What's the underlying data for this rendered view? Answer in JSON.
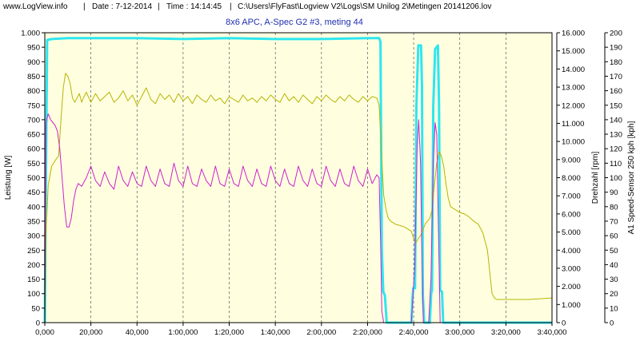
{
  "header": {
    "site": "www.LogView.info",
    "sep": "|",
    "date": "Date : 7-12-2014",
    "time": "Time : 14:14:45",
    "path": "C:\\Users\\FlyFast\\Logview V2\\Logs\\SM Unilog 2\\Metingen 20141206.lov"
  },
  "chart_data": {
    "type": "line",
    "title": "8x6 APC, A-Spec G2 #3, meting 44",
    "x": {
      "label": "",
      "unit": "seconds",
      "range": [
        0,
        220
      ],
      "ticks": [
        0,
        20,
        40,
        60,
        80,
        100,
        120,
        140,
        160,
        180,
        200,
        220
      ],
      "tick_labels": [
        "0,000",
        "20,000",
        "40,000",
        "1:00,000",
        "1:20,000",
        "1:40,000",
        "2:00,000",
        "2:20,000",
        "2:40,000",
        "3:00,000",
        "3:20,000",
        "3:40,000"
      ]
    },
    "axes": {
      "left": {
        "label": "Leistung [W]",
        "range": [
          0,
          1000
        ],
        "ticks": [
          0,
          50,
          100,
          150,
          200,
          250,
          300,
          350,
          400,
          450,
          500,
          550,
          600,
          650,
          700,
          750,
          800,
          850,
          900,
          950,
          1000
        ],
        "tick_labels": [
          "0",
          "50",
          "100",
          "150",
          "200",
          "250",
          "300",
          "350",
          "400",
          "450",
          "500",
          "550",
          "600",
          "650",
          "700",
          "750",
          "800",
          "850",
          "900",
          "950",
          "1.000"
        ]
      },
      "right1": {
        "label": "Drehzahl [rpm]",
        "range": [
          0,
          16000
        ],
        "ticks": [
          0,
          1000,
          2000,
          3000,
          4000,
          5000,
          6000,
          7000,
          8000,
          9000,
          10000,
          11000,
          12000,
          13000,
          14000,
          15000,
          16000
        ],
        "tick_labels": [
          "0",
          "1.000",
          "2.000",
          "3.000",
          "4.000",
          "5.000",
          "6.000",
          "7.000",
          "8.000",
          "9.000",
          "10.000",
          "11.000",
          "12.000",
          "13.000",
          "14.000",
          "15.000",
          "16.000"
        ]
      },
      "right2": {
        "label": "A1 Speed-Sensor 250 kph [kph]",
        "range": [
          0,
          200
        ],
        "ticks": [
          0,
          10,
          20,
          30,
          40,
          50,
          60,
          70,
          80,
          90,
          100,
          110,
          120,
          130,
          140,
          150,
          160,
          170,
          180,
          190,
          200
        ],
        "tick_labels": [
          "0",
          "10",
          "20",
          "30",
          "40",
          "50",
          "60",
          "70",
          "80",
          "90",
          "100",
          "110",
          "120",
          "130",
          "140",
          "150",
          "160",
          "170",
          "180",
          "190",
          "200"
        ]
      }
    },
    "series": [
      {
        "axis": "right1",
        "color": "#2ee6f0",
        "width": 3,
        "points": [
          [
            0,
            0
          ],
          [
            1,
            15600
          ],
          [
            3,
            15650
          ],
          [
            10,
            15700
          ],
          [
            20,
            15700
          ],
          [
            40,
            15700
          ],
          [
            60,
            15650
          ],
          [
            80,
            15700
          ],
          [
            100,
            15650
          ],
          [
            120,
            15650
          ],
          [
            140,
            15700
          ],
          [
            145,
            15700
          ],
          [
            145.6,
            15500
          ],
          [
            146.2,
            4000
          ],
          [
            146.8,
            1700
          ],
          [
            147.5,
            1500
          ],
          [
            148.3,
            0
          ],
          [
            159,
            0
          ],
          [
            159.4,
            1200
          ],
          [
            159.8,
            1900
          ],
          [
            160.6,
            1900
          ],
          [
            161.2,
            12000
          ],
          [
            162,
            15300
          ],
          [
            163.2,
            15300
          ],
          [
            163.6,
            13000
          ],
          [
            164,
            1500
          ],
          [
            164.6,
            0
          ],
          [
            167,
            0
          ],
          [
            167.6,
            1600
          ],
          [
            168,
            1800
          ],
          [
            168.5,
            12000
          ],
          [
            169.3,
            15100
          ],
          [
            170.5,
            15300
          ],
          [
            171,
            12000
          ],
          [
            171.5,
            1800
          ],
          [
            172.3,
            1700
          ],
          [
            172.8,
            0
          ],
          [
            220,
            0
          ]
        ]
      },
      {
        "axis": "right2",
        "color": "#b8b400",
        "width": 1,
        "points": [
          [
            0,
            0
          ],
          [
            0.5,
            60
          ],
          [
            1.5,
            95
          ],
          [
            3,
            108
          ],
          [
            5,
            113
          ],
          [
            6,
            115
          ],
          [
            7,
            140
          ],
          [
            8,
            162
          ],
          [
            9,
            172
          ],
          [
            10,
            170
          ],
          [
            11,
            165
          ],
          [
            12,
            155
          ],
          [
            13,
            152
          ],
          [
            14,
            155
          ],
          [
            15,
            158
          ],
          [
            16,
            152
          ],
          [
            17,
            156
          ],
          [
            18,
            159
          ],
          [
            20,
            152
          ],
          [
            22,
            158
          ],
          [
            24,
            153
          ],
          [
            26,
            156
          ],
          [
            28,
            159
          ],
          [
            30,
            152
          ],
          [
            32,
            155
          ],
          [
            34,
            160
          ],
          [
            36,
            153
          ],
          [
            38,
            157
          ],
          [
            40,
            150
          ],
          [
            42,
            156
          ],
          [
            44,
            162
          ],
          [
            46,
            154
          ],
          [
            48,
            151
          ],
          [
            50,
            158
          ],
          [
            52,
            154
          ],
          [
            54,
            157
          ],
          [
            56,
            152
          ],
          [
            58,
            158
          ],
          [
            60,
            153
          ],
          [
            62,
            156
          ],
          [
            64,
            151
          ],
          [
            66,
            157
          ],
          [
            68,
            154
          ],
          [
            70,
            152
          ],
          [
            72,
            157
          ],
          [
            74,
            153
          ],
          [
            76,
            155
          ],
          [
            78,
            151
          ],
          [
            80,
            156
          ],
          [
            82,
            154
          ],
          [
            84,
            152
          ],
          [
            86,
            157
          ],
          [
            88,
            153
          ],
          [
            90,
            155
          ],
          [
            92,
            152
          ],
          [
            94,
            156
          ],
          [
            96,
            153
          ],
          [
            98,
            157
          ],
          [
            100,
            154
          ],
          [
            102,
            152
          ],
          [
            104,
            158
          ],
          [
            106,
            153
          ],
          [
            108,
            156
          ],
          [
            110,
            152
          ],
          [
            112,
            157
          ],
          [
            114,
            154
          ],
          [
            116,
            151
          ],
          [
            118,
            156
          ],
          [
            120,
            153
          ],
          [
            122,
            157
          ],
          [
            124,
            154
          ],
          [
            126,
            152
          ],
          [
            128,
            156
          ],
          [
            130,
            153
          ],
          [
            132,
            157
          ],
          [
            134,
            154
          ],
          [
            136,
            152
          ],
          [
            138,
            156
          ],
          [
            140,
            153
          ],
          [
            142,
            156
          ],
          [
            144,
            155
          ],
          [
            145,
            150
          ],
          [
            146,
            120
          ],
          [
            147,
            88
          ],
          [
            148,
            78
          ],
          [
            149,
            72
          ],
          [
            150,
            70
          ],
          [
            152,
            68
          ],
          [
            154,
            67
          ],
          [
            156,
            66
          ],
          [
            158,
            64
          ],
          [
            159,
            63
          ],
          [
            160,
            58
          ],
          [
            161,
            55
          ],
          [
            162,
            58
          ],
          [
            163,
            60
          ],
          [
            164,
            64
          ],
          [
            165,
            68
          ],
          [
            166,
            70
          ],
          [
            167,
            72
          ],
          [
            168,
            78
          ],
          [
            169,
            95
          ],
          [
            170,
            110
          ],
          [
            171,
            118
          ],
          [
            172,
            115
          ],
          [
            173,
            108
          ],
          [
            174,
            96
          ],
          [
            175,
            86
          ],
          [
            176,
            80
          ],
          [
            178,
            78
          ],
          [
            180,
            76
          ],
          [
            182,
            75
          ],
          [
            184,
            73
          ],
          [
            186,
            70
          ],
          [
            188,
            68
          ],
          [
            190,
            62
          ],
          [
            192,
            50
          ],
          [
            193,
            35
          ],
          [
            194,
            20
          ],
          [
            195,
            17
          ],
          [
            196,
            16
          ],
          [
            200,
            16
          ],
          [
            210,
            16
          ],
          [
            220,
            17
          ]
        ]
      },
      {
        "axis": "left",
        "color": "#cc22cc",
        "width": 1,
        "points": [
          [
            0,
            0
          ],
          [
            0.5,
            690
          ],
          [
            1.5,
            720
          ],
          [
            2.5,
            700
          ],
          [
            3.5,
            690
          ],
          [
            4.5,
            680
          ],
          [
            5.5,
            660
          ],
          [
            6.5,
            600
          ],
          [
            7.5,
            500
          ],
          [
            8.5,
            400
          ],
          [
            9.5,
            330
          ],
          [
            10.5,
            330
          ],
          [
            11.5,
            360
          ],
          [
            12.5,
            420
          ],
          [
            13.5,
            460
          ],
          [
            14.5,
            480
          ],
          [
            16,
            470
          ],
          [
            18,
            500
          ],
          [
            20,
            540
          ],
          [
            22,
            490
          ],
          [
            24,
            470
          ],
          [
            26,
            520
          ],
          [
            28,
            480
          ],
          [
            30,
            460
          ],
          [
            32,
            540
          ],
          [
            34,
            490
          ],
          [
            36,
            470
          ],
          [
            38,
            520
          ],
          [
            40,
            480
          ],
          [
            42,
            470
          ],
          [
            44,
            540
          ],
          [
            46,
            490
          ],
          [
            48,
            470
          ],
          [
            50,
            530
          ],
          [
            52,
            480
          ],
          [
            54,
            470
          ],
          [
            56,
            550
          ],
          [
            58,
            490
          ],
          [
            60,
            470
          ],
          [
            62,
            540
          ],
          [
            64,
            480
          ],
          [
            66,
            470
          ],
          [
            68,
            530
          ],
          [
            70,
            490
          ],
          [
            72,
            470
          ],
          [
            74,
            540
          ],
          [
            76,
            480
          ],
          [
            78,
            470
          ],
          [
            80,
            530
          ],
          [
            82,
            480
          ],
          [
            84,
            470
          ],
          [
            86,
            540
          ],
          [
            88,
            490
          ],
          [
            90,
            470
          ],
          [
            92,
            530
          ],
          [
            94,
            480
          ],
          [
            96,
            470
          ],
          [
            98,
            540
          ],
          [
            100,
            490
          ],
          [
            102,
            470
          ],
          [
            104,
            530
          ],
          [
            106,
            480
          ],
          [
            108,
            470
          ],
          [
            110,
            540
          ],
          [
            112,
            490
          ],
          [
            114,
            470
          ],
          [
            116,
            530
          ],
          [
            118,
            480
          ],
          [
            120,
            470
          ],
          [
            122,
            540
          ],
          [
            124,
            490
          ],
          [
            126,
            470
          ],
          [
            128,
            530
          ],
          [
            130,
            480
          ],
          [
            132,
            470
          ],
          [
            134,
            540
          ],
          [
            136,
            490
          ],
          [
            138,
            470
          ],
          [
            140,
            530
          ],
          [
            142,
            480
          ],
          [
            144,
            510
          ],
          [
            145,
            500
          ],
          [
            145.6,
            300
          ],
          [
            146.2,
            40
          ],
          [
            147,
            0
          ],
          [
            158.5,
            0
          ],
          [
            159,
            0
          ],
          [
            160.5,
            200
          ],
          [
            161.5,
            600
          ],
          [
            162.2,
            700
          ],
          [
            163,
            550
          ],
          [
            163.6,
            200
          ],
          [
            164.2,
            0
          ],
          [
            166.5,
            0
          ],
          [
            167.5,
            150
          ],
          [
            168.5,
            550
          ],
          [
            169.3,
            690
          ],
          [
            170,
            650
          ],
          [
            170.8,
            300
          ],
          [
            171.5,
            0
          ],
          [
            220,
            0
          ]
        ]
      }
    ]
  }
}
